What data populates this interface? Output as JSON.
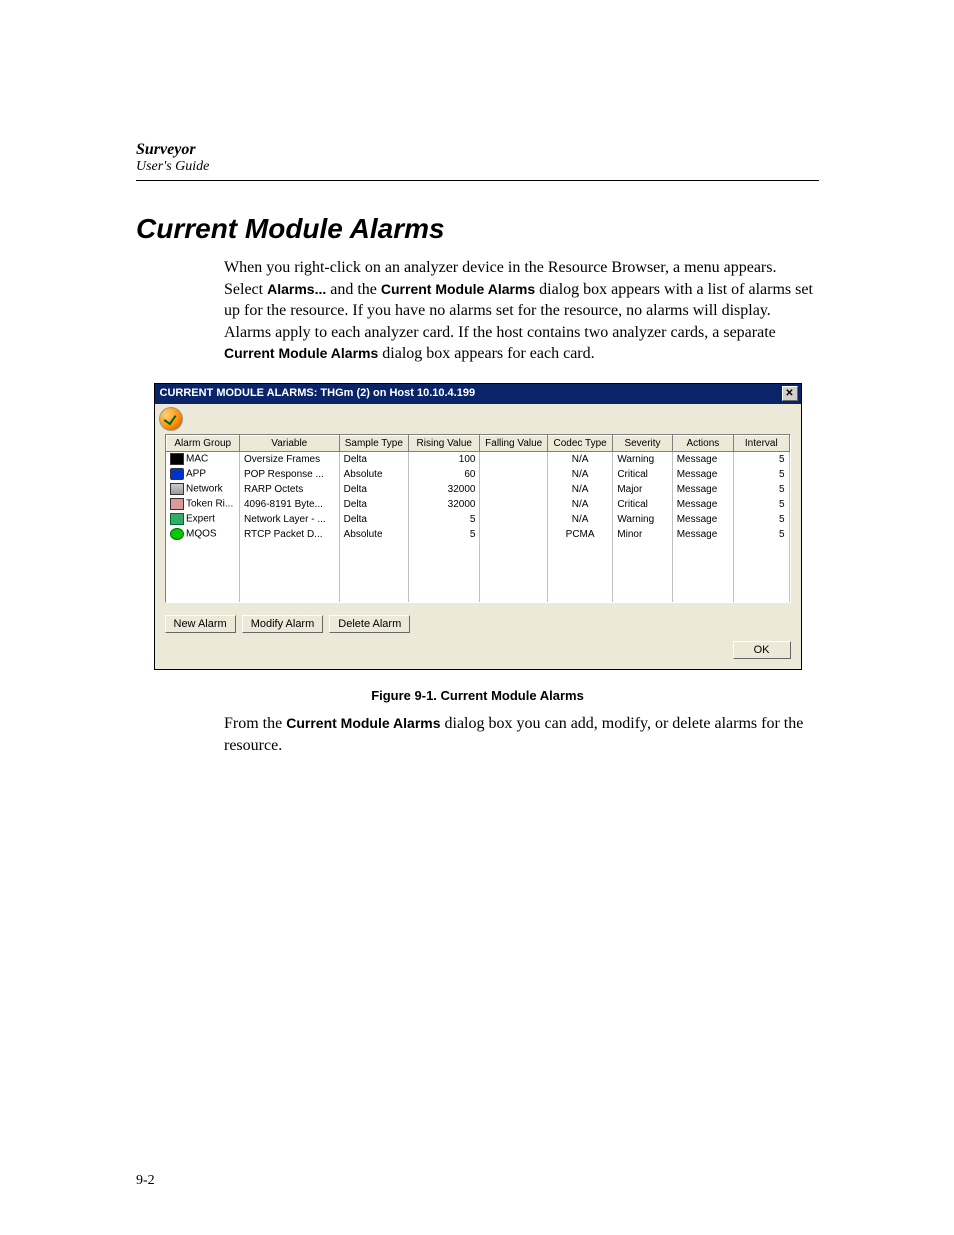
{
  "header": {
    "title": "Surveyor",
    "subtitle": "User's Guide"
  },
  "section_heading": "Current Module Alarms",
  "para1": {
    "t1": "When you right-click on an analyzer device in the Resource Browser, a menu appears. Select ",
    "alarms": "Alarms...",
    "t2": " and the ",
    "dialog": "Current Module Alarms",
    "t3": " dialog box appears with a list of alarms set up for the resource. If you have no alarms set for the resource, no alarms will display. Alarms apply to each analyzer card. If the host contains two analyzer cards, a separate ",
    "dialog2": "Current Module Alarms",
    "t4": " dialog box appears for each card."
  },
  "dialog": {
    "title": "CURRENT MODULE ALARMS: THGm (2) on Host 10.10.4.199",
    "columns": [
      "Alarm Group",
      "Variable",
      "Sample Type",
      "Rising Value",
      "Falling Value",
      "Codec Type",
      "Severity",
      "Actions",
      "Interval"
    ],
    "rows": [
      {
        "group": "MAC",
        "variable": "Oversize Frames",
        "sample": "Delta",
        "rising": "100",
        "falling": "",
        "codec": "N/A",
        "severity": "Warning",
        "actions": "Message",
        "interval": "5"
      },
      {
        "group": "APP",
        "variable": "POP Response ...",
        "sample": "Absolute",
        "rising": "60",
        "falling": "",
        "codec": "N/A",
        "severity": "Critical",
        "actions": "Message",
        "interval": "5"
      },
      {
        "group": "Network",
        "variable": "RARP Octets",
        "sample": "Delta",
        "rising": "32000",
        "falling": "",
        "codec": "N/A",
        "severity": "Major",
        "actions": "Message",
        "interval": "5"
      },
      {
        "group": "Token Ri...",
        "variable": "4096-8191 Byte...",
        "sample": "Delta",
        "rising": "32000",
        "falling": "",
        "codec": "N/A",
        "severity": "Critical",
        "actions": "Message",
        "interval": "5"
      },
      {
        "group": "Expert",
        "variable": "Network Layer - ...",
        "sample": "Delta",
        "rising": "5",
        "falling": "",
        "codec": "N/A",
        "severity": "Warning",
        "actions": "Message",
        "interval": "5"
      },
      {
        "group": "MQOS",
        "variable": "RTCP Packet D...",
        "sample": "Absolute",
        "rising": "5",
        "falling": "",
        "codec": "PCMA",
        "severity": "Minor",
        "actions": "Message",
        "interval": "5"
      }
    ],
    "buttons": {
      "new": "New Alarm",
      "modify": "Modify Alarm",
      "delete": "Delete Alarm",
      "ok": "OK"
    }
  },
  "figure_caption": "Figure 9-1.  Current Module Alarms",
  "para2": {
    "t1": "From the ",
    "dialog": "Current Module Alarms",
    "t2": " dialog box you can add, modify, or delete alarms for the resource."
  },
  "page_number": "9-2"
}
